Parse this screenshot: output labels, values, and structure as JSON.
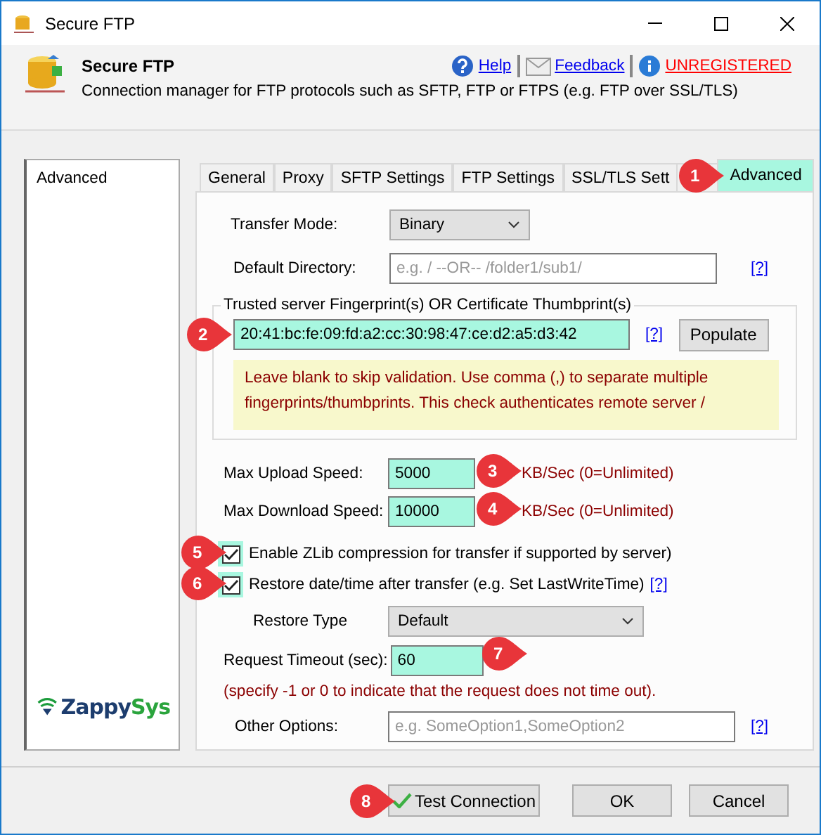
{
  "window": {
    "title": "Secure FTP"
  },
  "header": {
    "title": "Secure FTP",
    "description": "Connection manager for FTP protocols such as SFTP, FTP or FTPS (e.g. FTP over SSL/TLS)",
    "links": [
      {
        "kind": "help",
        "label": "Help",
        "alert": false
      },
      {
        "kind": "mail",
        "label": "Feedback",
        "alert": false
      },
      {
        "kind": "info",
        "label": "UNREGISTERED",
        "alert": true
      }
    ]
  },
  "sidebar": {
    "items": [
      {
        "label": "Advanced"
      }
    ],
    "logo": {
      "parts": [
        "Zappy",
        "Sys"
      ]
    }
  },
  "tabs": [
    {
      "label": "General",
      "selected": false
    },
    {
      "label": "Proxy",
      "selected": false
    },
    {
      "label": "SFTP Settings",
      "selected": false
    },
    {
      "label": "FTP Settings",
      "selected": false
    },
    {
      "label": "SSL/TLS Sett",
      "selected": false
    },
    {
      "label": "Advanced",
      "selected": true
    }
  ],
  "form": {
    "transfer_mode": {
      "label": "Transfer Mode:",
      "value": "Binary"
    },
    "default_directory": {
      "label": "Default Directory:",
      "placeholder": "e.g. /  --OR--  /folder1/sub1/",
      "help": "[?]"
    },
    "fingerprint": {
      "legend": "Trusted server Fingerprint(s) OR Certificate Thumbprint(s)",
      "value": "20:41:bc:fe:09:fd:a2:cc:30:98:47:ce:d2:a5:d3:42",
      "highlighted": true,
      "help": "[?]",
      "button": "Populate",
      "note": "Leave blank to skip validation. Use comma (,) to separate multiple fingerprints/thumbprints. This check authenticates remote server /"
    },
    "upload": {
      "label": "Max Upload Speed:",
      "value": "5000",
      "highlighted": true,
      "unit": "KB/Sec (0=Unlimited)"
    },
    "download": {
      "label": "Max Download Speed:",
      "value": "10000",
      "highlighted": true,
      "unit": "KB/Sec (0=Unlimited)"
    },
    "checkboxes": [
      {
        "label": "Enable ZLib compression for transfer if supported by server)",
        "checked": true,
        "highlighted": true
      },
      {
        "label": "Restore date/time after transfer (e.g. Set LastWriteTime)",
        "checked": true,
        "highlighted": true,
        "help": "[?]"
      }
    ],
    "restore_type": {
      "label": "Restore Type",
      "value": "Default"
    },
    "request_timeout": {
      "label": "Request Timeout (sec):",
      "value": "60",
      "highlighted": true,
      "note": "(specify -1 or 0 to indicate that the request does not time out)."
    },
    "other_options": {
      "label": "Other Options:",
      "placeholder": "e.g. SomeOption1,SomeOption2",
      "help": "[?]"
    }
  },
  "buttons": [
    {
      "kind": "test",
      "label": "Test Connection"
    },
    {
      "kind": "plain",
      "label": "OK"
    },
    {
      "kind": "plain",
      "label": "Cancel"
    }
  ],
  "callouts": [
    {
      "number": "1"
    },
    {
      "number": "2"
    },
    {
      "number": "3"
    },
    {
      "number": "4"
    },
    {
      "number": "5"
    },
    {
      "number": "6"
    },
    {
      "number": "7"
    },
    {
      "number": "8"
    }
  ]
}
